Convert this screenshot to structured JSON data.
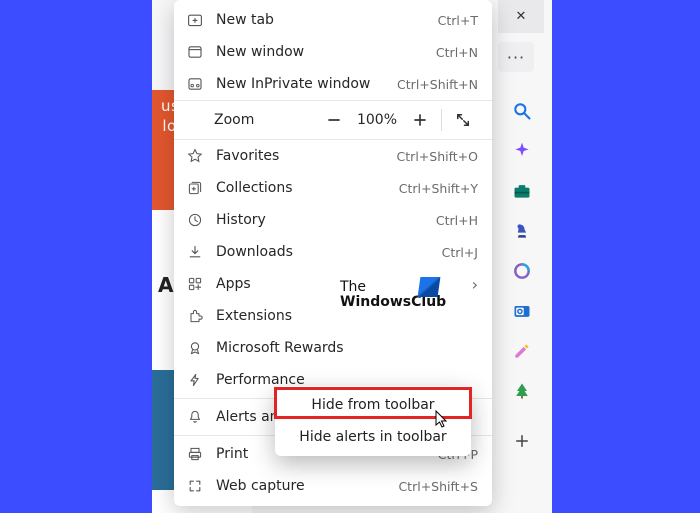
{
  "toolbar": {
    "close": "✕",
    "more": "···"
  },
  "menu": {
    "new_tab": {
      "label": "New tab",
      "shortcut": "Ctrl+T"
    },
    "new_window": {
      "label": "New window",
      "shortcut": "Ctrl+N"
    },
    "inprivate": {
      "label": "New InPrivate window",
      "shortcut": "Ctrl+Shift+N"
    },
    "zoom": {
      "label": "Zoom",
      "value": "100%"
    },
    "favorites": {
      "label": "Favorites",
      "shortcut": "Ctrl+Shift+O"
    },
    "collections": {
      "label": "Collections",
      "shortcut": "Ctrl+Shift+Y"
    },
    "history": {
      "label": "History",
      "shortcut": "Ctrl+H"
    },
    "downloads": {
      "label": "Downloads",
      "shortcut": "Ctrl+J"
    },
    "apps": {
      "label": "Apps"
    },
    "extensions": {
      "label": "Extensions"
    },
    "rewards": {
      "label": "Microsoft Rewards"
    },
    "performance": {
      "label": "Performance"
    },
    "alerts": {
      "label": "Alerts and tips"
    },
    "print": {
      "label": "Print",
      "shortcut": "Ctrl+P"
    },
    "webcapture": {
      "label": "Web capture",
      "shortcut": "Ctrl+Shift+S"
    }
  },
  "submenu": {
    "hide_from_toolbar": "Hide from toolbar",
    "hide_alerts": "Hide alerts in toolbar"
  },
  "watermark": {
    "line1": "The",
    "line2": "WindowsClub"
  },
  "behind": {
    "heading": "A",
    "orange": "us\nco\nlo\nou"
  },
  "side_icons": {
    "search": "search-icon",
    "copilot": "sparkle-icon",
    "work": "briefcase-icon",
    "games": "chess-icon",
    "loop": "loop-icon",
    "outlook": "outlook-icon",
    "edit": "pencil-icon",
    "tree": "tree-icon",
    "add": "plus-icon"
  }
}
